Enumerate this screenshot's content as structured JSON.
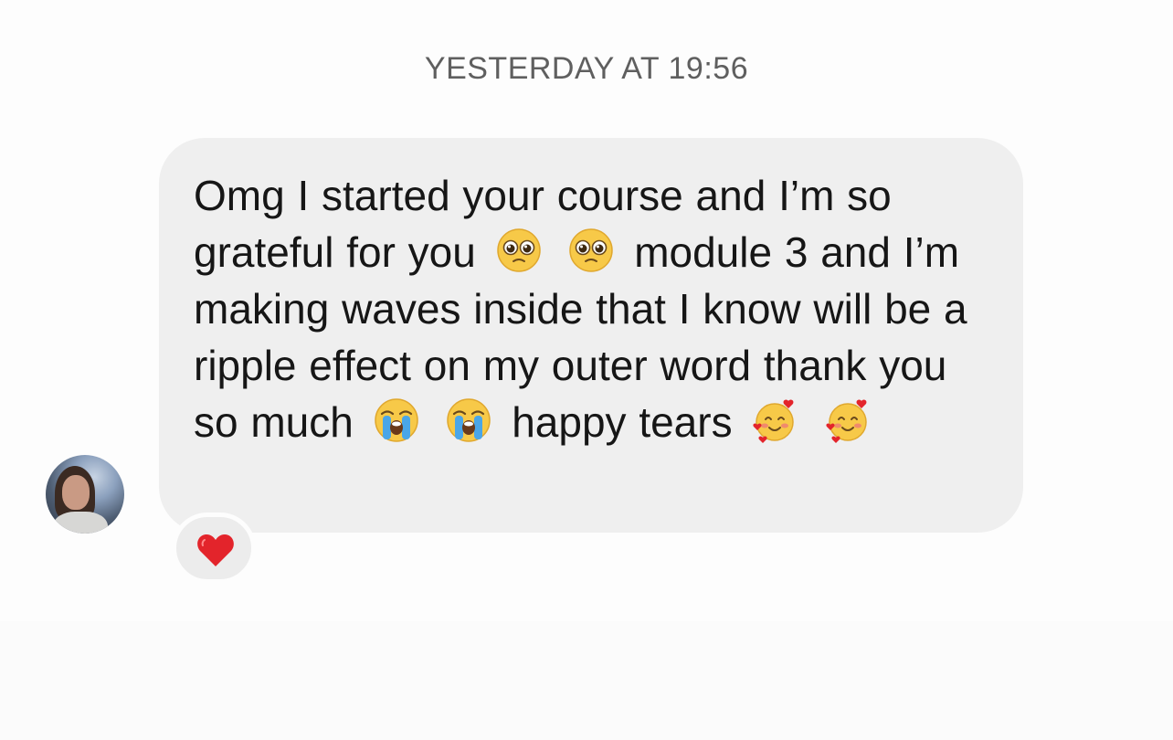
{
  "conversation": {
    "timestamp": "YESTERDAY AT 19:56"
  },
  "message": {
    "segments": [
      {
        "type": "text",
        "text": "Omg I started your course and I’m so grateful for you"
      },
      {
        "type": "emoji",
        "icon": "pleading-face-icon"
      },
      {
        "type": "emoji",
        "icon": "pleading-face-icon"
      },
      {
        "type": "text",
        "text": "module 3 and I’m making waves inside that I know will be a ripple effect on my outer word thank you so much"
      },
      {
        "type": "emoji",
        "icon": "loudly-crying-face-icon"
      },
      {
        "type": "emoji",
        "icon": "loudly-crying-face-icon"
      },
      {
        "type": "text",
        "text": "happy tears"
      },
      {
        "type": "emoji",
        "icon": "smiling-face-with-hearts-icon"
      },
      {
        "type": "emoji",
        "icon": "smiling-face-with-hearts-icon"
      }
    ],
    "bubble_color": "#efefef",
    "reaction": {
      "icon": "red-heart-icon",
      "color": "#e3242b"
    }
  },
  "sender": {
    "avatar_icon": "profile-photo"
  }
}
